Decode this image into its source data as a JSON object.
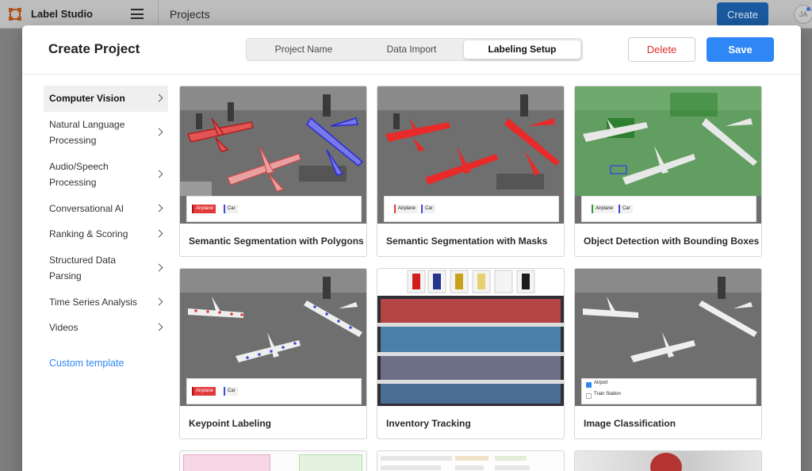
{
  "app": {
    "name": "Label Studio",
    "breadcrumb": "Projects",
    "create_label": "Create",
    "avatar_initials": "JA"
  },
  "modal": {
    "title": "Create Project",
    "tabs": [
      {
        "label": "Project Name",
        "active": false
      },
      {
        "label": "Data Import",
        "active": false
      },
      {
        "label": "Labeling Setup",
        "active": true
      }
    ],
    "delete_label": "Delete",
    "save_label": "Save"
  },
  "sidebar": {
    "items": [
      {
        "label": "Computer Vision",
        "active": true
      },
      {
        "label": "Natural Language Processing",
        "active": false
      },
      {
        "label": "Audio/Speech Processing",
        "active": false
      },
      {
        "label": "Conversational AI",
        "active": false
      },
      {
        "label": "Ranking & Scoring",
        "active": false
      },
      {
        "label": "Structured Data Parsing",
        "active": false
      },
      {
        "label": "Time Series Analysis",
        "active": false
      },
      {
        "label": "Videos",
        "active": false
      }
    ],
    "custom_template": "Custom template"
  },
  "templates": [
    {
      "title": "Semantic Segmentation with Polygons",
      "labels": [
        "Airplane",
        "Car"
      ]
    },
    {
      "title": "Semantic Segmentation with Masks",
      "labels": [
        "Airplane",
        "Car"
      ]
    },
    {
      "title": "Object Detection with Bounding Boxes",
      "labels": [
        "Airplane",
        "Car"
      ]
    },
    {
      "title": "Keypoint Labeling",
      "labels": [
        "Airplane",
        "Car"
      ]
    },
    {
      "title": "Inventory Tracking"
    },
    {
      "title": "Image Classification",
      "choices": [
        "Airport",
        "Train Station"
      ]
    }
  ],
  "colors": {
    "accent": "#2f87f5",
    "danger": "#dd2b2b",
    "airplane": "#e23a3a",
    "car": "#3d4cd6"
  }
}
